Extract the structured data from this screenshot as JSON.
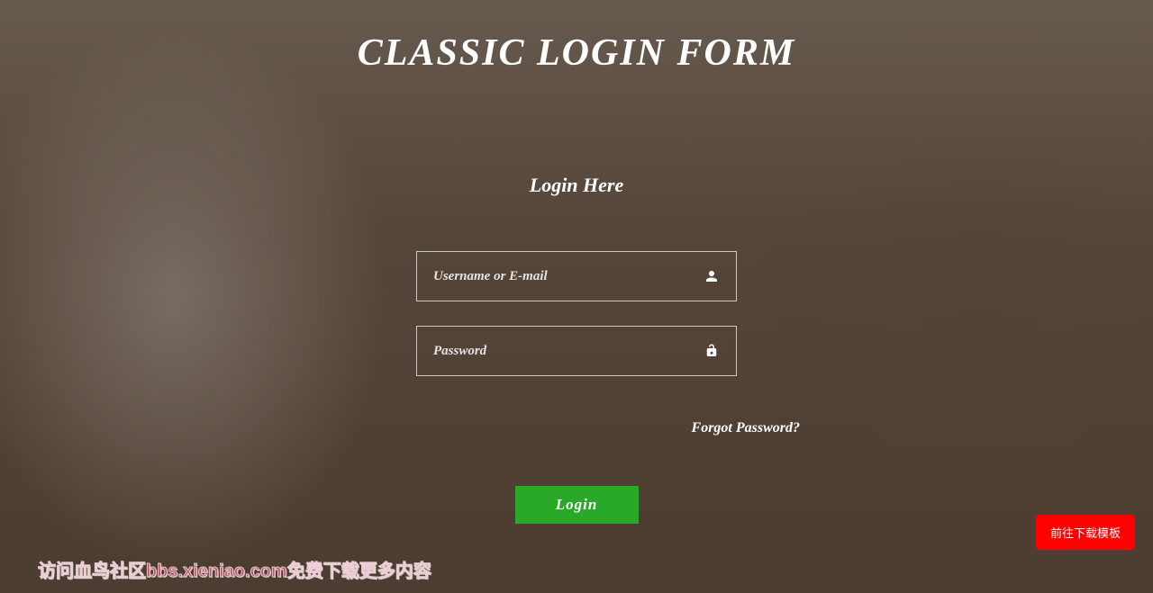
{
  "header": {
    "title": "CLASSIC LOGIN FORM"
  },
  "form": {
    "heading": "Login Here",
    "username": {
      "placeholder": "Username or E-mail",
      "value": ""
    },
    "password": {
      "placeholder": "Password",
      "value": ""
    },
    "forgot_label": "Forgot Password?",
    "submit_label": "Login"
  },
  "download_button": "前往下载模板",
  "watermark": "访问血鸟社区bbs.xieniao.com免费下载更多内容",
  "colors": {
    "accent": "#2aa827",
    "danger": "#ff0000"
  }
}
